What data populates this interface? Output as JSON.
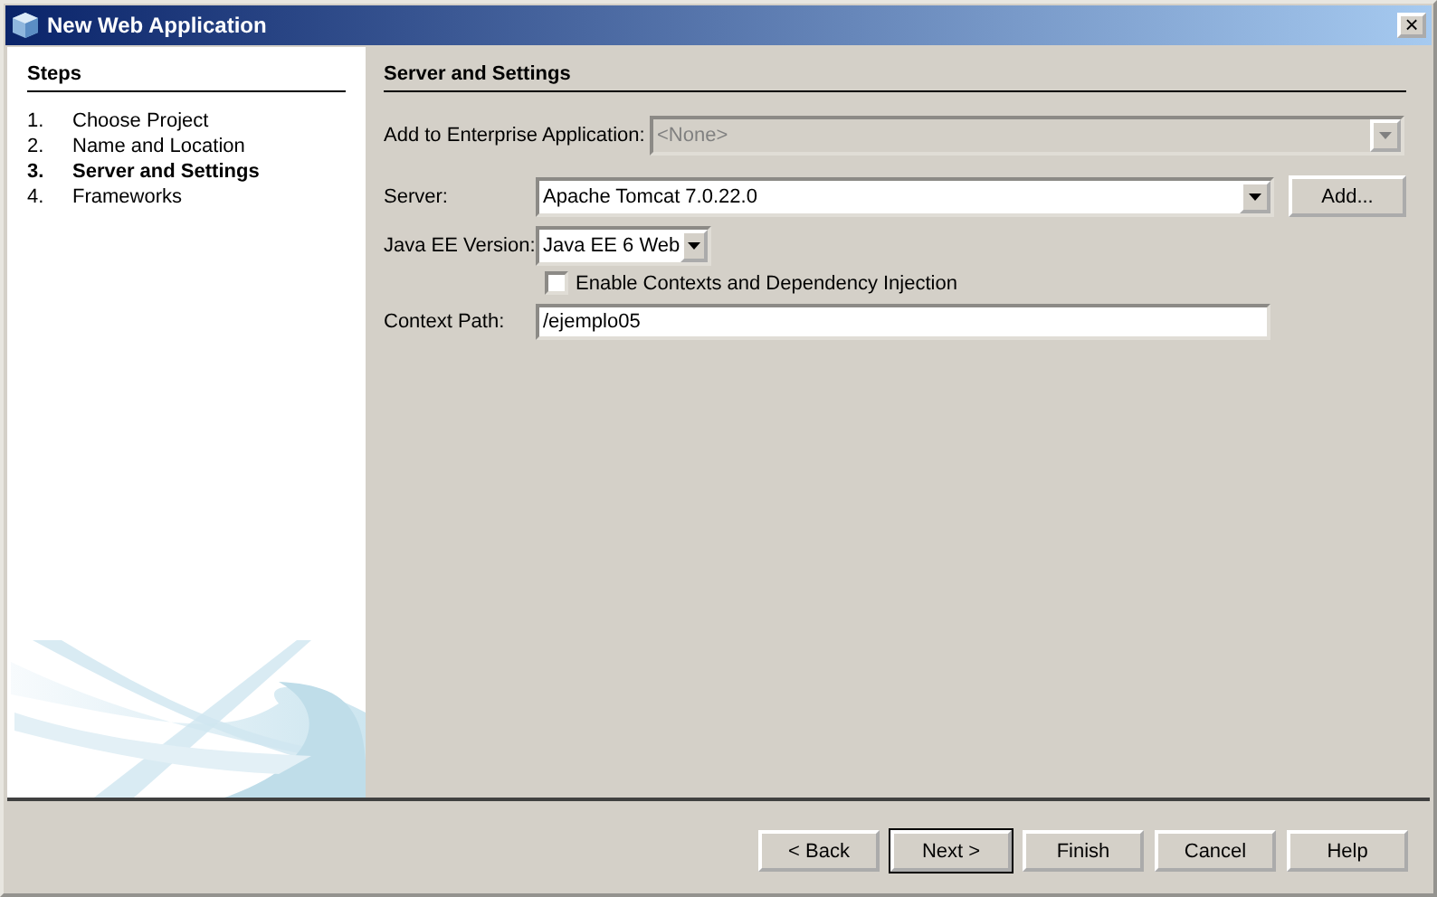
{
  "window": {
    "title": "New Web Application",
    "close": "×"
  },
  "steps": {
    "title": "Steps",
    "items": [
      {
        "number": "1.",
        "label": "Choose Project",
        "selected": false
      },
      {
        "number": "2.",
        "label": "Name and Location",
        "selected": false
      },
      {
        "number": "3.",
        "label": "Server and Settings",
        "selected": true
      },
      {
        "number": "4.",
        "label": "Frameworks",
        "selected": false
      }
    ]
  },
  "panel": {
    "title": "Server and Settings",
    "enterprise": {
      "label": "Add to Enterprise Application:",
      "value": "<None>",
      "disabled": true
    },
    "server": {
      "label": "Server:",
      "value": "Apache Tomcat 7.0.22.0",
      "disabled": false,
      "button": "Add..."
    },
    "java_ee": {
      "label": "Java EE Version:",
      "value": "Java EE 6 Web",
      "disabled": false
    },
    "cdi": {
      "label": "Enable Contexts and Dependency Injection",
      "checked": false
    },
    "context_path": {
      "label": "Context Path:",
      "value": "/ejemplo05"
    }
  },
  "buttons": [
    {
      "label": "< Back",
      "default": false
    },
    {
      "label": "Next >",
      "default": true
    },
    {
      "label": "Finish",
      "default": false
    },
    {
      "label": "Cancel",
      "default": false
    },
    {
      "label": "Help",
      "default": false
    }
  ]
}
